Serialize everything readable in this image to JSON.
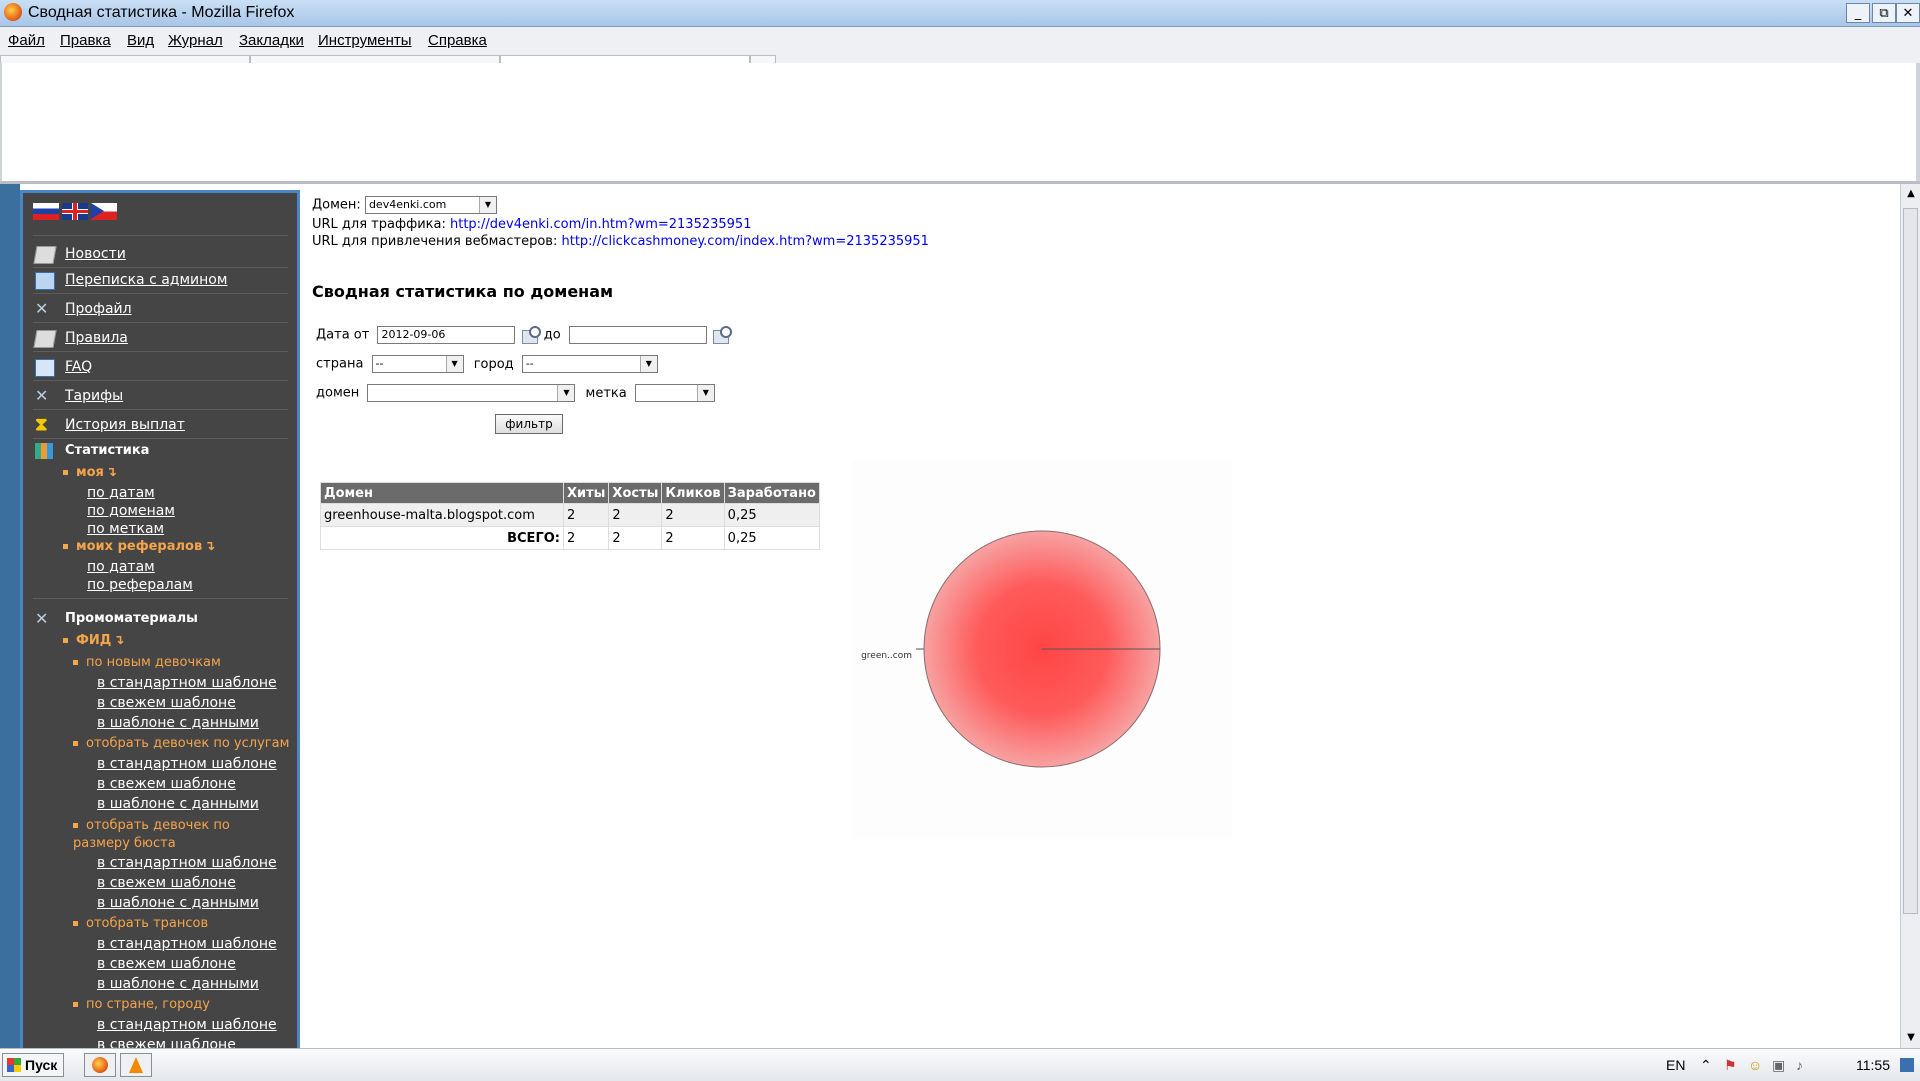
{
  "window": {
    "title": "Сводная статистика - Mozilla Firefox",
    "buttons": {
      "minimize": "_",
      "restore": "⧉",
      "close": "✕"
    }
  },
  "menubar": [
    "Файл",
    "Правка",
    "Вид",
    "Журнал",
    "Закладки",
    "Инструменты",
    "Справка"
  ],
  "sidebar": {
    "languages": [
      "ru-flag-icon",
      "uk-flag-icon",
      "cz-flag-icon"
    ],
    "items": [
      {
        "label": "Новости",
        "icon": "book-icon"
      },
      {
        "label": "Переписка с админом",
        "icon": "mail-icon"
      },
      {
        "label": "Профайл",
        "icon": "tools-icon"
      },
      {
        "label": "Правила",
        "icon": "book-icon"
      },
      {
        "label": "FAQ",
        "icon": "faq-icon"
      },
      {
        "label": "Тарифы",
        "icon": "tools-icon"
      },
      {
        "label": "История выплат",
        "icon": "hourglass-icon"
      }
    ],
    "stats": {
      "header": "Статистика",
      "mine": {
        "label": "моя",
        "links": [
          "по датам",
          "по доменам",
          "по меткам"
        ]
      },
      "referrals": {
        "label": "моих рефералов",
        "links": [
          "по датам",
          "по рефералам"
        ]
      }
    },
    "promo": {
      "header": "Промоматериалы",
      "feed": "ФИД",
      "groups": [
        {
          "label": "по новым девочкам",
          "links": [
            "в стандартном шаблоне",
            "в свежем шаблоне",
            "в шаблоне с данными"
          ]
        },
        {
          "label": "отобрать девочек по услугам",
          "links": [
            "в стандартном шаблоне",
            "в свежем шаблоне",
            "в шаблоне с данными"
          ]
        },
        {
          "label": "отобрать девочек по размеру бюста",
          "links": [
            "в стандартном шаблоне",
            "в свежем шаблоне",
            "в шаблоне с данными"
          ]
        },
        {
          "label": "отобрать трансов",
          "links": [
            "в стандартном шаблоне",
            "в свежем шаблоне",
            "в шаблоне с данными"
          ]
        },
        {
          "label": "по стране, городу",
          "links": [
            "в стандартном шаблоне",
            "в свежем шаблоне"
          ]
        }
      ]
    }
  },
  "main": {
    "domain_label": "Домен:",
    "domain_value": "dev4enki.com",
    "traffic_url_label": "URL для траффика:",
    "traffic_url": "http://dev4enki.com/in.htm?wm=2135235951",
    "webmaster_url_label": "URL для привлечения вебмастеров:",
    "webmaster_url": "http://clickcashmoney.com/index.htm?wm=2135235951",
    "heading": "Сводная статистика по доменам",
    "filter": {
      "date_from_label": "Дата от",
      "date_from_value": "2012-09-06",
      "date_to_label": "до",
      "date_to_value": "",
      "country_label": "страна",
      "country_value": "--",
      "city_label": "город",
      "city_value": "--",
      "domain_label": "домен",
      "domain_value": "",
      "tag_label": "метка",
      "tag_value": "",
      "button": "фильтр"
    },
    "table": {
      "headers": [
        "Домен",
        "Хиты",
        "Хосты",
        "Кликов",
        "Заработано"
      ],
      "rows": [
        [
          "greenhouse-malta.blogspot.com",
          "2",
          "2",
          "2",
          "0,25"
        ]
      ],
      "total": [
        "ВСЕГО:",
        "2",
        "2",
        "2",
        "0,25"
      ]
    }
  },
  "chart_data": {
    "type": "pie",
    "categories": [
      "green..com"
    ],
    "values": [
      100
    ],
    "colors": [
      "#ff4b4b"
    ]
  },
  "taskbar": {
    "start": "Пуск",
    "apps": [
      "firefox-icon",
      "vlc-icon"
    ],
    "lang": "EN",
    "clock": "11:55"
  }
}
